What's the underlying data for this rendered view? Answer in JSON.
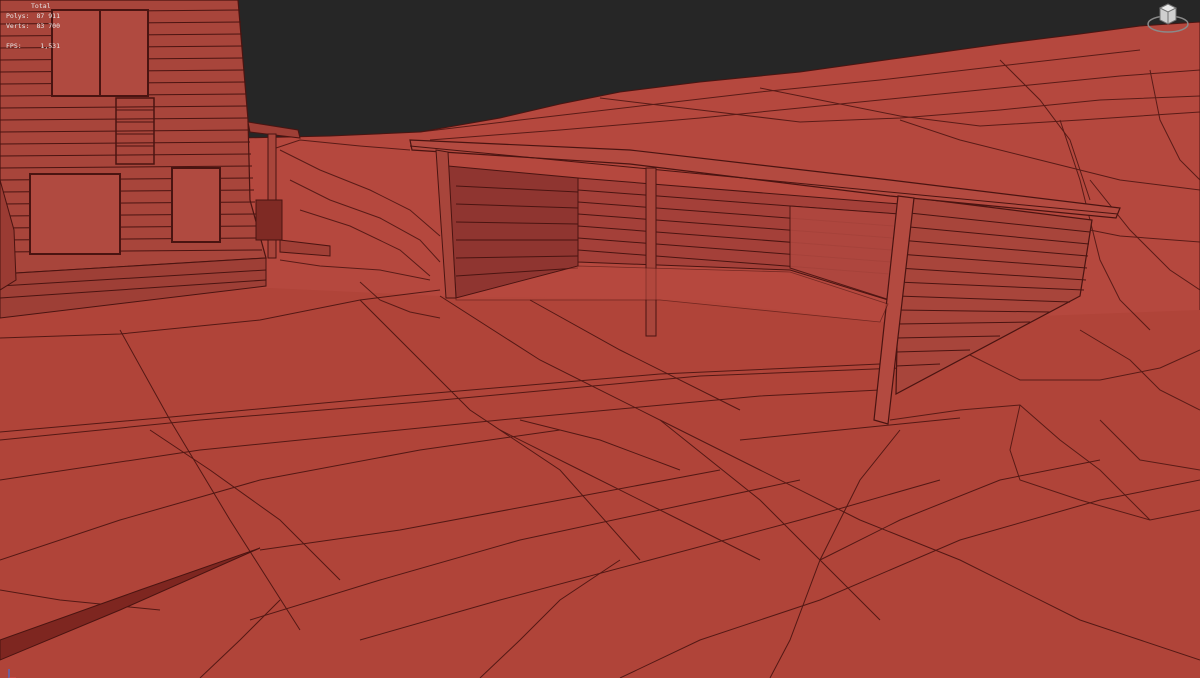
{
  "stats": {
    "header": "Total",
    "rows": [
      {
        "label": "Polys:",
        "value": "87 911"
      },
      {
        "label": "Verts:",
        "value": "83 700"
      },
      {
        "label": "FPS:",
        "value": "1,531"
      }
    ]
  },
  "viewcube": {
    "icon": "viewcube-icon"
  },
  "axis": {
    "icon": "axis-tripod-icon"
  },
  "colors": {
    "background": "#262626",
    "terrain": "#b5483e",
    "terrain_dark": "#9e3a32",
    "wire": "#4a1411",
    "wall_inner": "#9a3b33",
    "house": "#a8453b"
  }
}
